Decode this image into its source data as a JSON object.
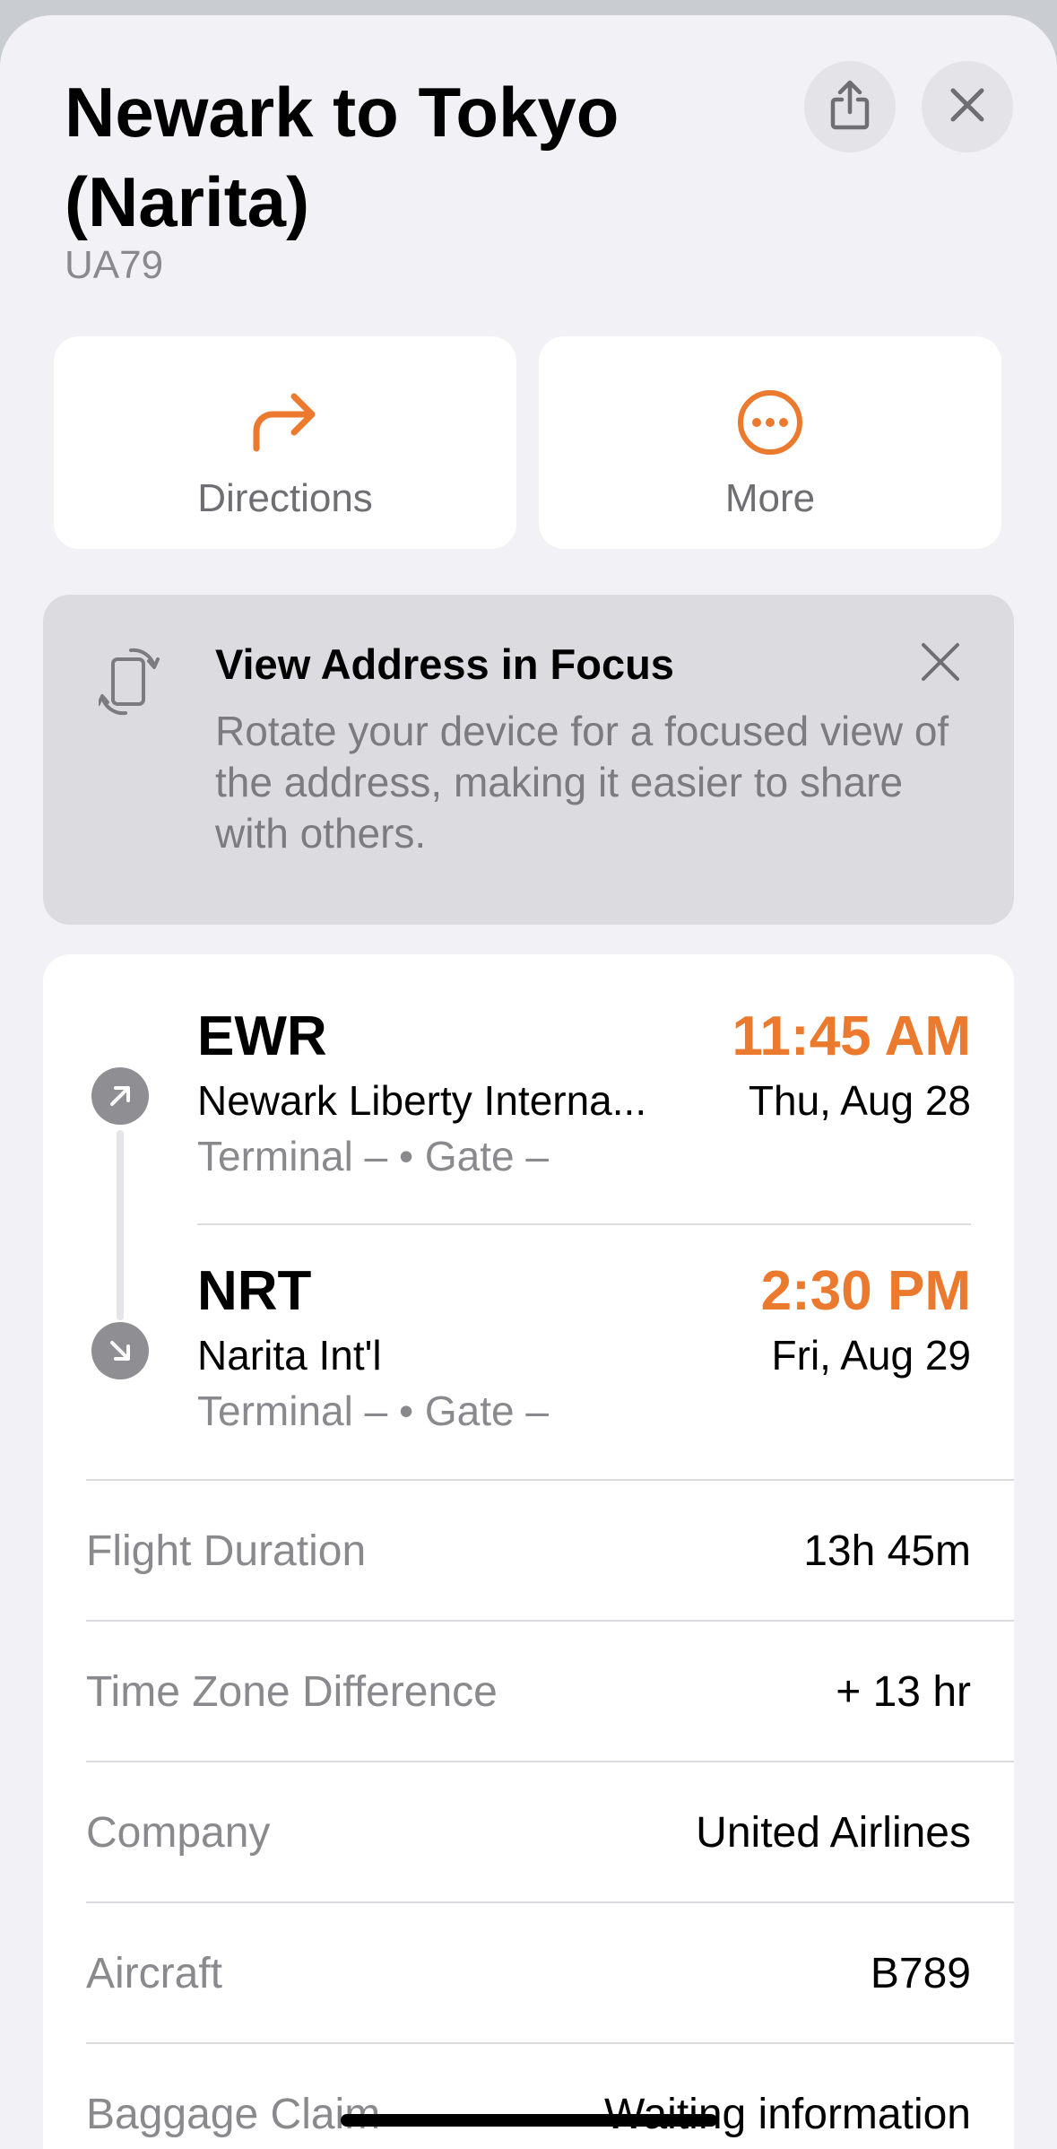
{
  "header": {
    "title": "Newark to Tokyo (Narita)",
    "flight_number": "UA79",
    "share_icon": "share-icon",
    "close_icon": "close-icon"
  },
  "actions": [
    {
      "label": "Directions",
      "icon": "directions-arrow-icon"
    },
    {
      "label": "More",
      "icon": "more-ellipsis-icon"
    }
  ],
  "tip": {
    "title": "View Address in Focus",
    "body": "Rotate your device for a focused view of the address, making it easier to share with others.",
    "icon": "rotate-device-icon"
  },
  "flight": {
    "departure": {
      "code": "EWR",
      "airport": "Newark Liberty Interna...",
      "terminal_gate": "Terminal – • Gate –",
      "time": "11:45 AM",
      "date": "Thu, Aug 28"
    },
    "arrival": {
      "code": "NRT",
      "airport": "Narita Int'l",
      "terminal_gate": "Terminal – • Gate –",
      "time": "2:30 PM",
      "date": "Fri, Aug 29"
    }
  },
  "details": [
    {
      "label": "Flight Duration",
      "value": "13h 45m"
    },
    {
      "label": "Time Zone Difference",
      "value": "+ 13 hr"
    },
    {
      "label": "Company",
      "value": "United Airlines"
    },
    {
      "label": "Aircraft",
      "value": "B789"
    },
    {
      "label": "Baggage Claim",
      "value": "Waiting information"
    }
  ],
  "colors": {
    "accent": "#eb7a2f",
    "background": "#f2f2f6",
    "secondary_text": "#8a8a8e"
  }
}
